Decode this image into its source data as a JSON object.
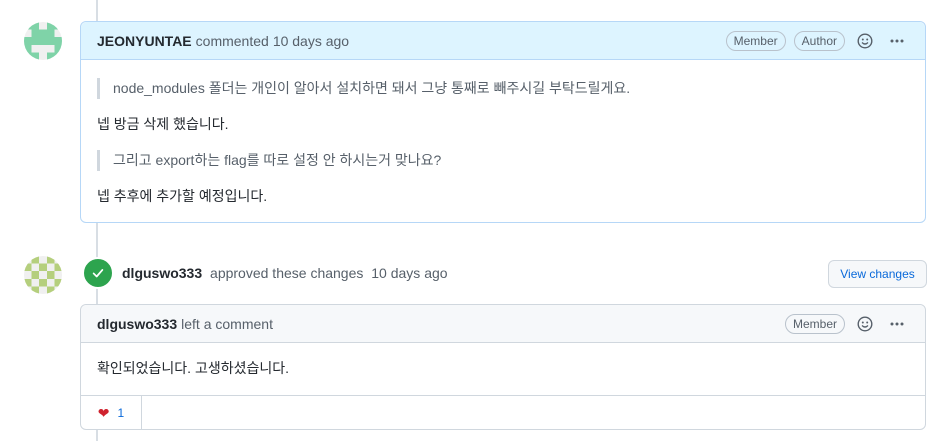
{
  "comment1": {
    "author": "JEONYUNTAE",
    "action": "commented",
    "time": "10 days ago",
    "badges": [
      "Member",
      "Author"
    ],
    "quote1": "node_modules 폴더는 개인이 알아서 설치하면 돼서 그냥 통째로 빼주시길 부탁드릴게요.",
    "reply1": "넵 방금 삭제 했습니다.",
    "quote2": "그리고 export하는 flag를 따로 설정 안 하시는거 맞나요?",
    "reply2": "넵 추후에 추가할 예정입니다.",
    "avatar_color": "#7fd3a8"
  },
  "approval": {
    "author": "dlguswo333",
    "action": "approved these changes",
    "time": "10 days ago",
    "view_changes_label": "View changes",
    "status_color": "#2da44e"
  },
  "comment2": {
    "author": "dlguswo333",
    "action": "left a comment",
    "badge": "Member",
    "text": "확인되었습니다. 고생하셨습니다.",
    "reaction_count": "1",
    "avatar_color": "#b5cf7d"
  },
  "icons": {
    "smiley": "smiley-icon",
    "kebab": "kebab-horizontal-icon",
    "check": "check-icon",
    "heart": "heart-icon"
  }
}
